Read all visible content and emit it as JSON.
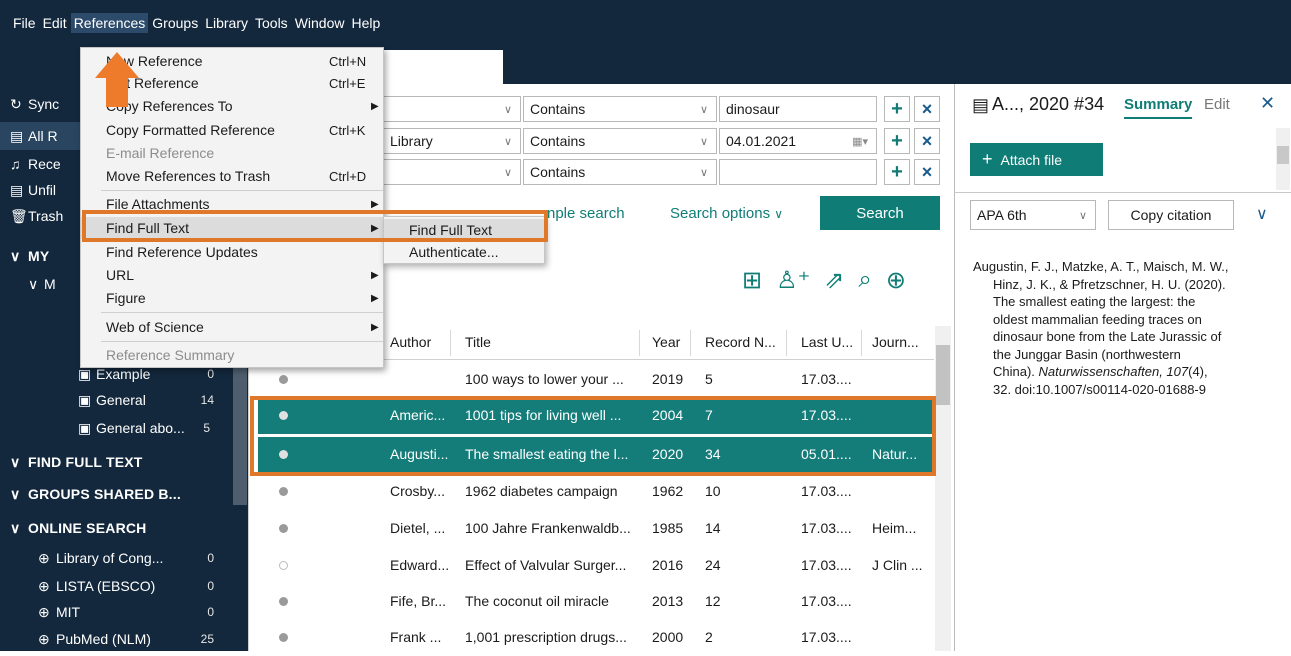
{
  "menubar": [
    "File",
    "Edit",
    "References",
    "Groups",
    "Library",
    "Tools",
    "Window",
    "Help"
  ],
  "sidebar": {
    "sync": "Sync",
    "all_refs": "All R",
    "recent": "Rece",
    "unfiled": "Unfil",
    "trash": "Trash",
    "my_groups": "MY",
    "sub_m": "M",
    "example": {
      "label": "Example",
      "count": "0"
    },
    "general": {
      "label": "General",
      "count": "14"
    },
    "general_abo": {
      "label": "General abo...",
      "count": "5"
    },
    "find_full_text": "FIND FULL TEXT",
    "groups_shared": "GROUPS SHARED B...",
    "online_search": "ONLINE SEARCH",
    "online": [
      {
        "label": "Library of Cong...",
        "count": "0"
      },
      {
        "label": "LISTA (EBSCO)",
        "count": "0"
      },
      {
        "label": "MIT",
        "count": "0"
      },
      {
        "label": "PubMed (NLM)",
        "count": "25"
      }
    ]
  },
  "references_menu": {
    "items": [
      {
        "label": "New Reference",
        "shortcut": "Ctrl+N"
      },
      {
        "label": "Edit Reference",
        "shortcut": "Ctrl+E"
      },
      {
        "label": "Copy References To",
        "submenu": true
      },
      {
        "label": "Copy Formatted Reference",
        "shortcut": "Ctrl+K"
      },
      {
        "label": "E-mail Reference",
        "disabled": true
      },
      {
        "label": "Move References to Trash",
        "shortcut": "Ctrl+D"
      },
      {
        "label": "File Attachments",
        "submenu": true
      },
      {
        "label": "Find Full Text",
        "submenu": true
      },
      {
        "label": "Find Reference Updates"
      },
      {
        "label": "URL",
        "submenu": true
      },
      {
        "label": "Figure",
        "submenu": true
      },
      {
        "label": "Web of Science",
        "submenu": true
      },
      {
        "label": "Reference Summary",
        "disabled": true
      }
    ],
    "submenu": [
      "Find Full Text",
      "Authenticate..."
    ]
  },
  "search": {
    "rows": [
      {
        "field": "",
        "op": "Contains",
        "value": "dinosaur"
      },
      {
        "field": "Library",
        "op": "Contains",
        "value": "04.01.2021"
      },
      {
        "field": "",
        "op": "Contains",
        "value": ""
      }
    ],
    "simple_search": "nple search",
    "search_options": "Search options",
    "search_button": "Search"
  },
  "table": {
    "headers": [
      "Author",
      "Title",
      "Year",
      "Record N...",
      "Last U...",
      "Journ..."
    ],
    "rows": [
      {
        "author": "",
        "title": "100 ways to lower your ...",
        "year": "2019",
        "rec": "5",
        "last": "17.03....",
        "journal": "",
        "hl": false
      },
      {
        "author": "Americ...",
        "title": "1001 tips for living well ...",
        "year": "2004",
        "rec": "7",
        "last": "17.03....",
        "journal": "",
        "hl": true
      },
      {
        "author": "Augusti...",
        "title": "The smallest eating the l...",
        "year": "2020",
        "rec": "34",
        "last": "05.01....",
        "journal": "Natur...",
        "hl": true
      },
      {
        "author": "Crosby...",
        "title": "1962 diabetes campaign",
        "year": "1962",
        "rec": "10",
        "last": "17.03....",
        "journal": "",
        "hl": false
      },
      {
        "author": "Dietel, ...",
        "title": "100 Jahre Frankenwaldb...",
        "year": "1985",
        "rec": "14",
        "last": "17.03....",
        "journal": "Heim...",
        "hl": false
      },
      {
        "author": "Edward...",
        "title": "Effect of Valvular Surger...",
        "year": "2016",
        "rec": "24",
        "last": "17.03....",
        "journal": "J Clin ...",
        "hl": false
      },
      {
        "author": "Fife, Br...",
        "title": "The coconut oil miracle",
        "year": "2013",
        "rec": "12",
        "last": "17.03....",
        "journal": "",
        "hl": false
      },
      {
        "author": "Frank ...",
        "title": "1,001 prescription drugs...",
        "year": "2000",
        "rec": "2",
        "last": "17.03....",
        "journal": "",
        "hl": false
      }
    ]
  },
  "right_panel": {
    "title": "A..., 2020 #34",
    "tab_summary": "Summary",
    "tab_edit": "Edit",
    "attach_file": "Attach file",
    "style": "APA 6th",
    "copy_citation": "Copy citation",
    "citation_lines": [
      "Augustin, F. J., Matzke, A. T., Maisch, M. W.,",
      "Hinz, J. K., & Pfretzschner, H. U. (2020).",
      "The smallest eating the largest: the",
      "oldest mammalian feeding traces on",
      "dinosaur bone from the Late Jurassic of",
      "the Junggar Basin (northwestern",
      "China). ",
      "32. doi:10.1007/s00114-020-01688-9"
    ],
    "journal_italic": "Naturwissenschaften, 107",
    "issue": "(4),"
  },
  "colors": {
    "accent": "#0f7d76",
    "sidebar": "#13283d",
    "annotation": "#e0782a"
  }
}
